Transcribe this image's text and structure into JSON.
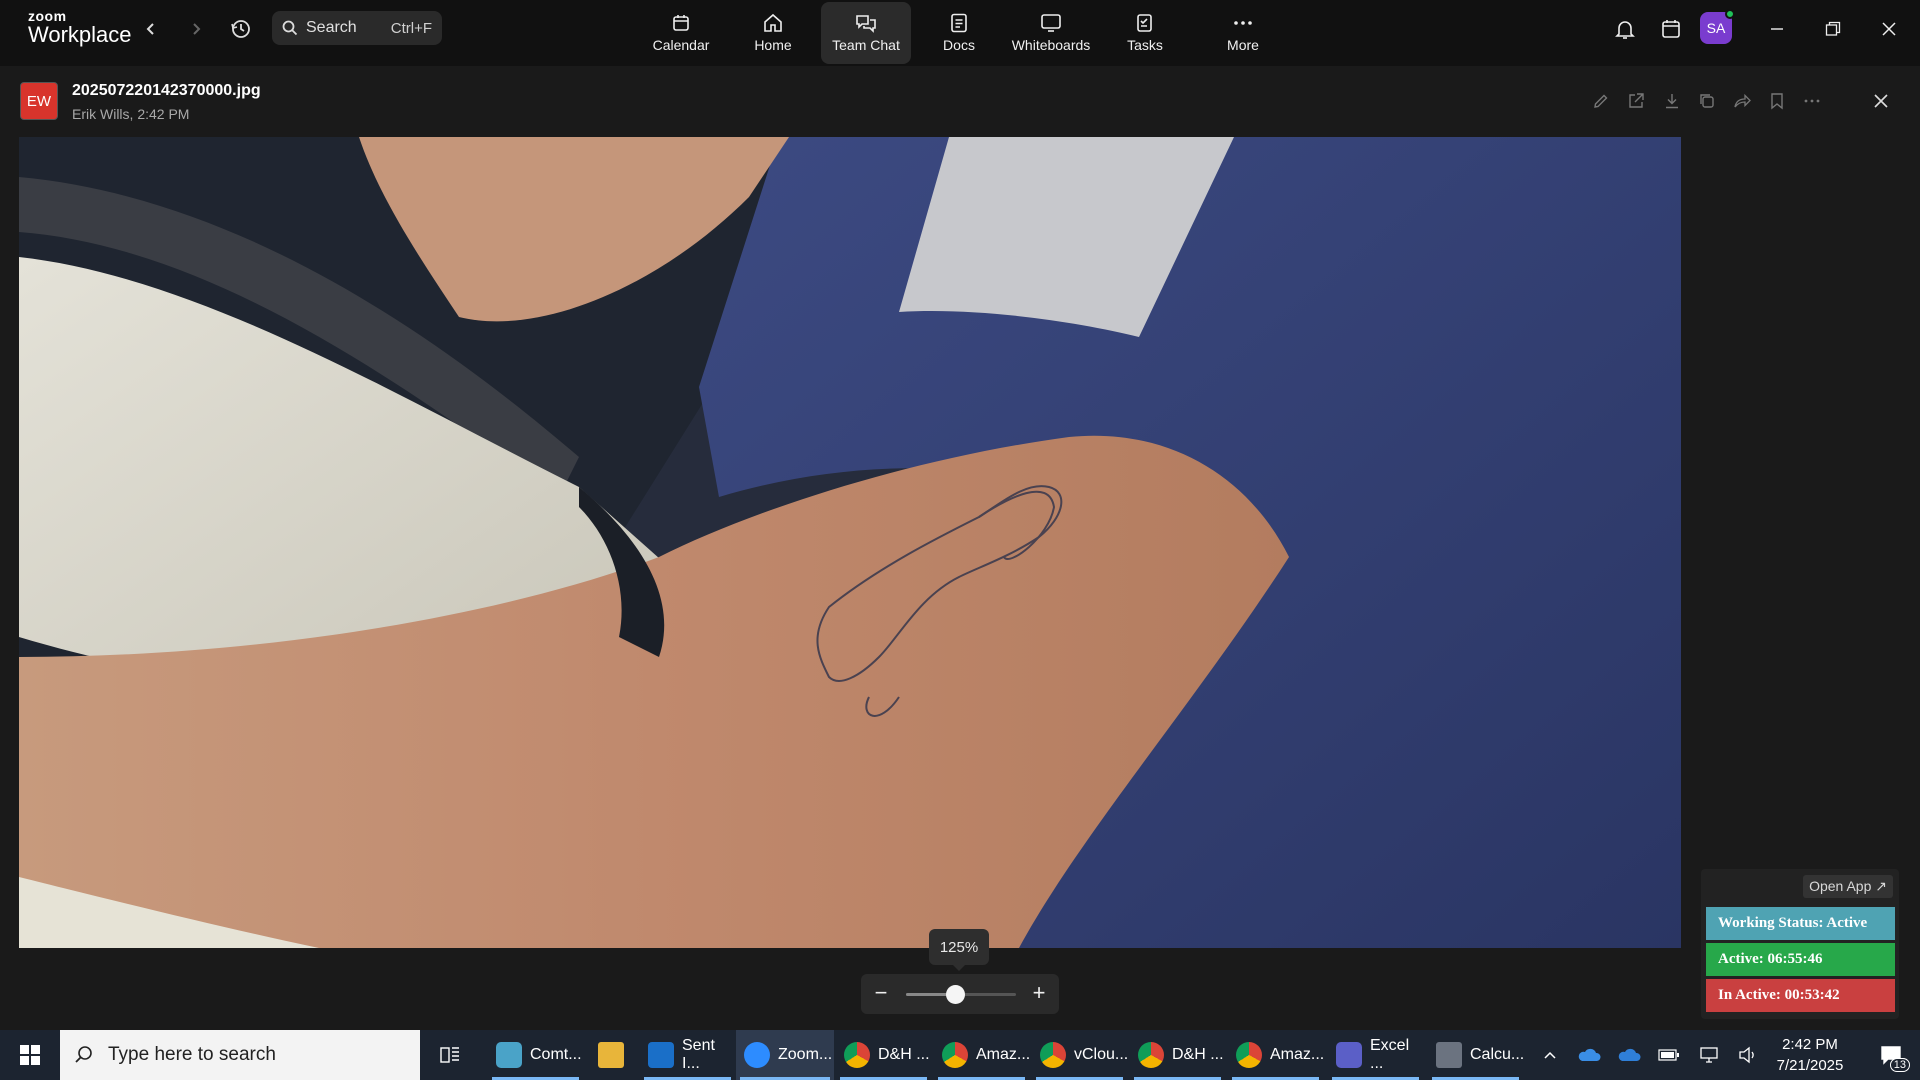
{
  "app": {
    "logo_small": "zoom",
    "logo_big": "Workplace",
    "search_label": "Search",
    "search_shortcut": "Ctrl+F",
    "tabs": [
      {
        "label": "Calendar",
        "icon": "calendar-icon"
      },
      {
        "label": "Home",
        "icon": "home-icon"
      },
      {
        "label": "Team Chat",
        "icon": "chat-icon",
        "active": true
      },
      {
        "label": "Docs",
        "icon": "docs-icon"
      },
      {
        "label": "Whiteboards",
        "icon": "whiteboard-icon"
      },
      {
        "label": "Tasks",
        "icon": "tasks-icon"
      },
      {
        "label": "More",
        "icon": "more-icon"
      }
    ],
    "avatar_initials": "SA"
  },
  "viewer": {
    "sender_initials": "EW",
    "file_name": "202507220142370000.jpg",
    "meta": "Erik Wills, 2:42 PM",
    "zoom_level": "125%",
    "zoom_fraction": 0.45
  },
  "status_widget": {
    "open_app": "Open App ↗",
    "working": "Working Status: Active",
    "active": "Active: 06:55:46",
    "inactive": "In Active: 00:53:42",
    "colors": {
      "working": "#4fa3b3",
      "active": "#27a84a",
      "inactive": "#c94040"
    }
  },
  "taskbar": {
    "search_placeholder": "Type here to search",
    "items": [
      {
        "label": "Comt...",
        "icon": "contour-icon"
      },
      {
        "label": "",
        "icon": "file-explorer-icon"
      },
      {
        "label": "Sent I...",
        "icon": "outlook-icon"
      },
      {
        "label": "Zoom...",
        "icon": "zoom-icon",
        "active": true
      },
      {
        "label": "D&H ...",
        "icon": "chrome-icon"
      },
      {
        "label": "Amaz...",
        "icon": "chrome-icon"
      },
      {
        "label": "vClou...",
        "icon": "chrome-icon"
      },
      {
        "label": "D&H ...",
        "icon": "chrome-icon"
      },
      {
        "label": "Amaz...",
        "icon": "chrome-icon"
      },
      {
        "label": "Excel ...",
        "icon": "teams-icon"
      },
      {
        "label": "Calcu...",
        "icon": "calculator-icon"
      }
    ],
    "time": "2:42 PM",
    "date": "7/21/2025",
    "notification_count": "13"
  }
}
